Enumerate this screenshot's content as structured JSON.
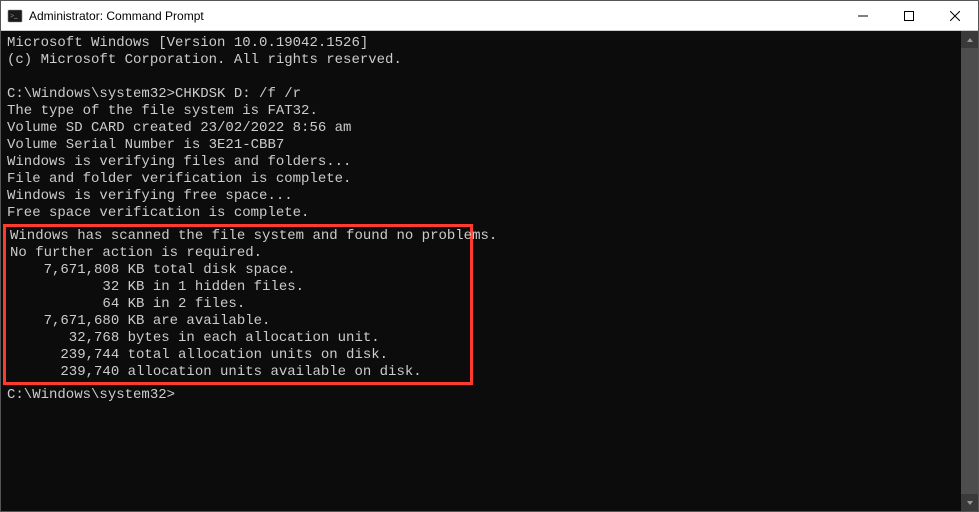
{
  "window": {
    "title": "Administrator: Command Prompt"
  },
  "header": {
    "line1": "Microsoft Windows [Version 10.0.19042.1526]",
    "line2": "(c) Microsoft Corporation. All rights reserved."
  },
  "cmd": {
    "prompt1": "C:\\Windows\\system32>",
    "command1": "CHKDSK D: /f /r",
    "out1": "The type of the file system is FAT32.",
    "out2": "Volume SD CARD created 23/02/2022 8:56 am",
    "out3": "Volume Serial Number is 3E21-CBB7",
    "out4": "Windows is verifying files and folders...",
    "out5": "File and folder verification is complete.",
    "out6": "Windows is verifying free space...",
    "out7": "Free space verification is complete."
  },
  "result": {
    "r1": "Windows has scanned the file system and found no problems.",
    "r2": "No further action is required.",
    "r3": "    7,671,808 KB total disk space.",
    "r4": "           32 KB in 1 hidden files.",
    "r5": "           64 KB in 2 files.",
    "r6": "    7,671,680 KB are available.",
    "r7": "",
    "r8": "       32,768 bytes in each allocation unit.",
    "r9": "      239,744 total allocation units on disk.",
    "r10": "      239,740 allocation units available on disk."
  },
  "footer": {
    "prompt2": "C:\\Windows\\system32>"
  }
}
